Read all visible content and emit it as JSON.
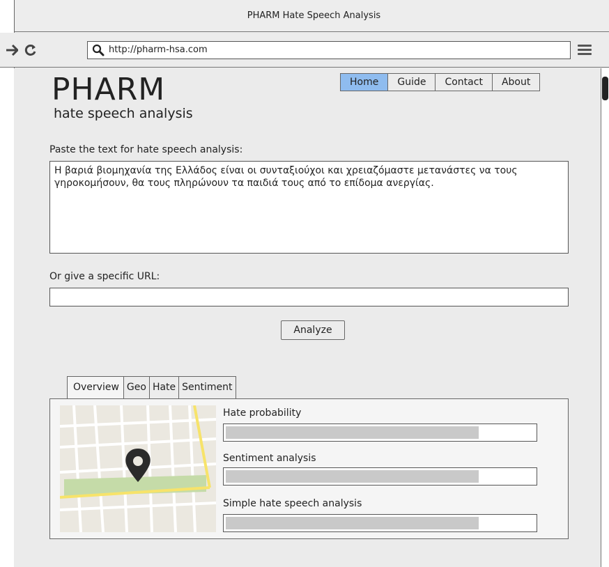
{
  "window": {
    "title": "PHARM Hate Speech Analysis"
  },
  "browser": {
    "back_icon": "arrow-left-icon",
    "forward_icon": "arrow-right-icon",
    "reload_icon": "reload-icon",
    "url": "http://pharm-hsa.com"
  },
  "header": {
    "logo": "PHARM",
    "tagline": "hate speech analysis"
  },
  "topnav": {
    "items": [
      {
        "label": "Home",
        "active": true
      },
      {
        "label": "Guide",
        "active": false
      },
      {
        "label": "Contact",
        "active": false
      },
      {
        "label": "About",
        "active": false
      }
    ]
  },
  "form": {
    "text_label": "Paste the text for hate speech analysis:",
    "text_value": "Η βαριά βιομηχανία της Ελλάδος είναι οι συνταξιούχοι και χρειαζόμαστε μετανάστες να τους γηροκομήσουν, θα τους πληρώνουν τα παιδιά τους από το επίδομα ανεργίας.",
    "url_label": "Or give a specific URL:",
    "url_value": "",
    "analyze_label": "Analyze"
  },
  "results": {
    "tabs": [
      "Overview",
      "Geo",
      "Hate",
      "Sentiment"
    ],
    "active_tab": "Overview",
    "metrics": [
      {
        "label": "Hate probability",
        "fill": 0.82
      },
      {
        "label": "Sentiment analysis",
        "fill": 0.82
      },
      {
        "label": "Simple hate speech analysis",
        "fill": 0.82
      }
    ]
  },
  "colors": {
    "active_tab": "#8fbcef",
    "map_road_yellow": "#f7e36a",
    "map_park": "#c5dba8",
    "map_pin": "#2b2b2b"
  }
}
